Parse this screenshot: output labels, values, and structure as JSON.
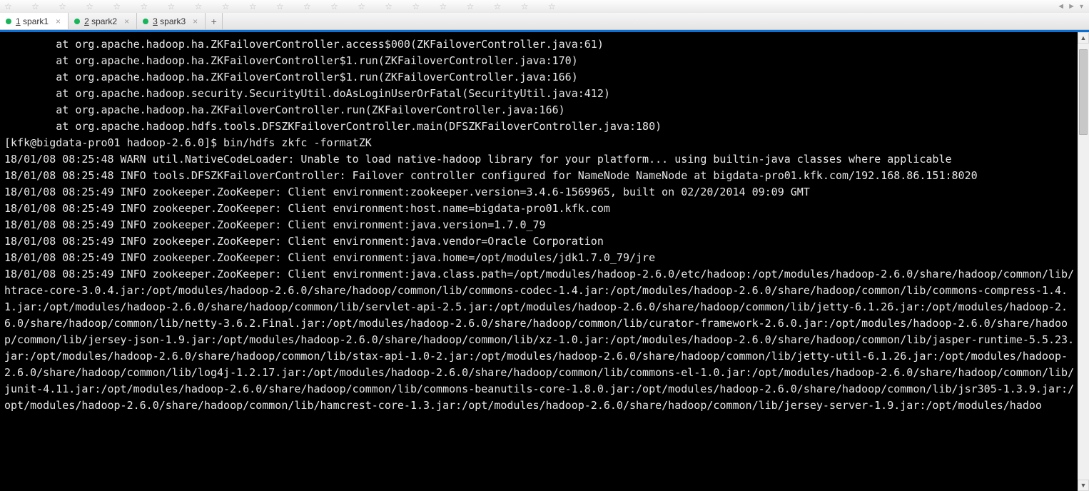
{
  "tabs": [
    {
      "num": "1",
      "name": "spark1",
      "dot": "#18b45a",
      "active": true
    },
    {
      "num": "2",
      "name": "spark2",
      "dot": "#18b45a",
      "active": false
    },
    {
      "num": "3",
      "name": "spark3",
      "dot": "#18b45a",
      "active": false
    }
  ],
  "nav": {
    "left": "◄",
    "right": "►",
    "menu": "▾"
  },
  "stars_placeholder": "☆ ☆ ☆ ☆ ☆ ☆ ☆ ☆ ☆ ☆ ☆ ☆ ☆ ☆ ☆ ☆ ☆ ☆ ☆ ☆ ☆",
  "tab_add": "+",
  "terminal_lines": [
    "        at org.apache.hadoop.ha.ZKFailoverController.access$000(ZKFailoverController.java:61)",
    "        at org.apache.hadoop.ha.ZKFailoverController$1.run(ZKFailoverController.java:170)",
    "        at org.apache.hadoop.ha.ZKFailoverController$1.run(ZKFailoverController.java:166)",
    "        at org.apache.hadoop.security.SecurityUtil.doAsLoginUserOrFatal(SecurityUtil.java:412)",
    "        at org.apache.hadoop.ha.ZKFailoverController.run(ZKFailoverController.java:166)",
    "        at org.apache.hadoop.hdfs.tools.DFSZKFailoverController.main(DFSZKFailoverController.java:180)",
    "[kfk@bigdata-pro01 hadoop-2.6.0]$ bin/hdfs zkfc -formatZK",
    "18/01/08 08:25:48 WARN util.NativeCodeLoader: Unable to load native-hadoop library for your platform... using builtin-java classes where applicable",
    "18/01/08 08:25:48 INFO tools.DFSZKFailoverController: Failover controller configured for NameNode NameNode at bigdata-pro01.kfk.com/192.168.86.151:8020",
    "18/01/08 08:25:49 INFO zookeeper.ZooKeeper: Client environment:zookeeper.version=3.4.6-1569965, built on 02/20/2014 09:09 GMT",
    "18/01/08 08:25:49 INFO zookeeper.ZooKeeper: Client environment:host.name=bigdata-pro01.kfk.com",
    "18/01/08 08:25:49 INFO zookeeper.ZooKeeper: Client environment:java.version=1.7.0_79",
    "18/01/08 08:25:49 INFO zookeeper.ZooKeeper: Client environment:java.vendor=Oracle Corporation",
    "18/01/08 08:25:49 INFO zookeeper.ZooKeeper: Client environment:java.home=/opt/modules/jdk1.7.0_79/jre",
    "18/01/08 08:25:49 INFO zookeeper.ZooKeeper: Client environment:java.class.path=/opt/modules/hadoop-2.6.0/etc/hadoop:/opt/modules/hadoop-2.6.0/share/hadoop/common/lib/htrace-core-3.0.4.jar:/opt/modules/hadoop-2.6.0/share/hadoop/common/lib/commons-codec-1.4.jar:/opt/modules/hadoop-2.6.0/share/hadoop/common/lib/commons-compress-1.4.1.jar:/opt/modules/hadoop-2.6.0/share/hadoop/common/lib/servlet-api-2.5.jar:/opt/modules/hadoop-2.6.0/share/hadoop/common/lib/jetty-6.1.26.jar:/opt/modules/hadoop-2.6.0/share/hadoop/common/lib/netty-3.6.2.Final.jar:/opt/modules/hadoop-2.6.0/share/hadoop/common/lib/curator-framework-2.6.0.jar:/opt/modules/hadoop-2.6.0/share/hadoop/common/lib/jersey-json-1.9.jar:/opt/modules/hadoop-2.6.0/share/hadoop/common/lib/xz-1.0.jar:/opt/modules/hadoop-2.6.0/share/hadoop/common/lib/jasper-runtime-5.5.23.jar:/opt/modules/hadoop-2.6.0/share/hadoop/common/lib/stax-api-1.0-2.jar:/opt/modules/hadoop-2.6.0/share/hadoop/common/lib/jetty-util-6.1.26.jar:/opt/modules/hadoop-2.6.0/share/hadoop/common/lib/log4j-1.2.17.jar:/opt/modules/hadoop-2.6.0/share/hadoop/common/lib/commons-el-1.0.jar:/opt/modules/hadoop-2.6.0/share/hadoop/common/lib/junit-4.11.jar:/opt/modules/hadoop-2.6.0/share/hadoop/common/lib/commons-beanutils-core-1.8.0.jar:/opt/modules/hadoop-2.6.0/share/hadoop/common/lib/jsr305-1.3.9.jar:/opt/modules/hadoop-2.6.0/share/hadoop/common/lib/hamcrest-core-1.3.jar:/opt/modules/hadoop-2.6.0/share/hadoop/common/lib/jersey-server-1.9.jar:/opt/modules/hadoo"
  ]
}
